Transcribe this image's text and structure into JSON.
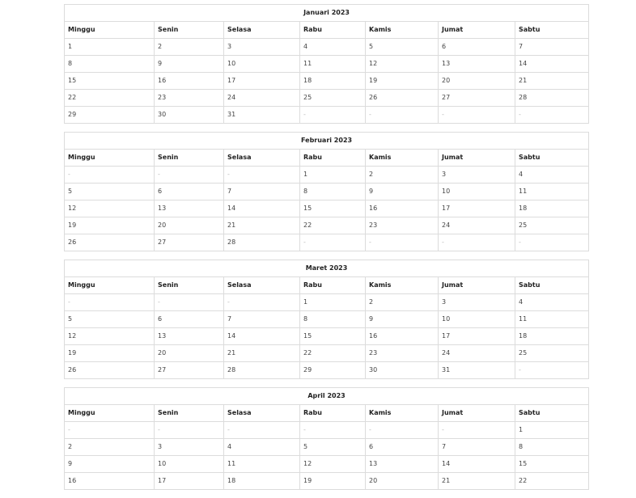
{
  "day_headers": [
    "Minggu",
    "Senin",
    "Selasa",
    "Rabu",
    "Kamis",
    "Jumat",
    "Sabtu"
  ],
  "months": [
    {
      "title": "Januari 2023",
      "weeks": [
        [
          "1",
          "2",
          "3",
          "4",
          "5",
          "6",
          "7"
        ],
        [
          "8",
          "9",
          "10",
          "11",
          "12",
          "13",
          "14"
        ],
        [
          "15",
          "16",
          "17",
          "18",
          "19",
          "20",
          "21"
        ],
        [
          "22",
          "23",
          "24",
          "25",
          "26",
          "27",
          "28"
        ],
        [
          "29",
          "30",
          "31",
          "-",
          "-",
          "-",
          "-"
        ]
      ]
    },
    {
      "title": "Februari 2023",
      "weeks": [
        [
          "-",
          "-",
          "-",
          "1",
          "2",
          "3",
          "4"
        ],
        [
          "5",
          "6",
          "7",
          "8",
          "9",
          "10",
          "11"
        ],
        [
          "12",
          "13",
          "14",
          "15",
          "16",
          "17",
          "18"
        ],
        [
          "19",
          "20",
          "21",
          "22",
          "23",
          "24",
          "25"
        ],
        [
          "26",
          "27",
          "28",
          "-",
          "-",
          "-",
          "-"
        ]
      ]
    },
    {
      "title": "Maret 2023",
      "weeks": [
        [
          "-",
          "-",
          "-",
          "1",
          "2",
          "3",
          "4"
        ],
        [
          "5",
          "6",
          "7",
          "8",
          "9",
          "10",
          "11"
        ],
        [
          "12",
          "13",
          "14",
          "15",
          "16",
          "17",
          "18"
        ],
        [
          "19",
          "20",
          "21",
          "22",
          "23",
          "24",
          "25"
        ],
        [
          "26",
          "27",
          "28",
          "29",
          "30",
          "31",
          "-"
        ]
      ]
    },
    {
      "title": "April 2023",
      "weeks": [
        [
          "-",
          "-",
          "-",
          "-",
          "-",
          "-",
          "1"
        ],
        [
          "2",
          "3",
          "4",
          "5",
          "6",
          "7",
          "8"
        ],
        [
          "9",
          "10",
          "11",
          "12",
          "13",
          "14",
          "15"
        ],
        [
          "16",
          "17",
          "18",
          "19",
          "20",
          "21",
          "22"
        ]
      ]
    }
  ]
}
